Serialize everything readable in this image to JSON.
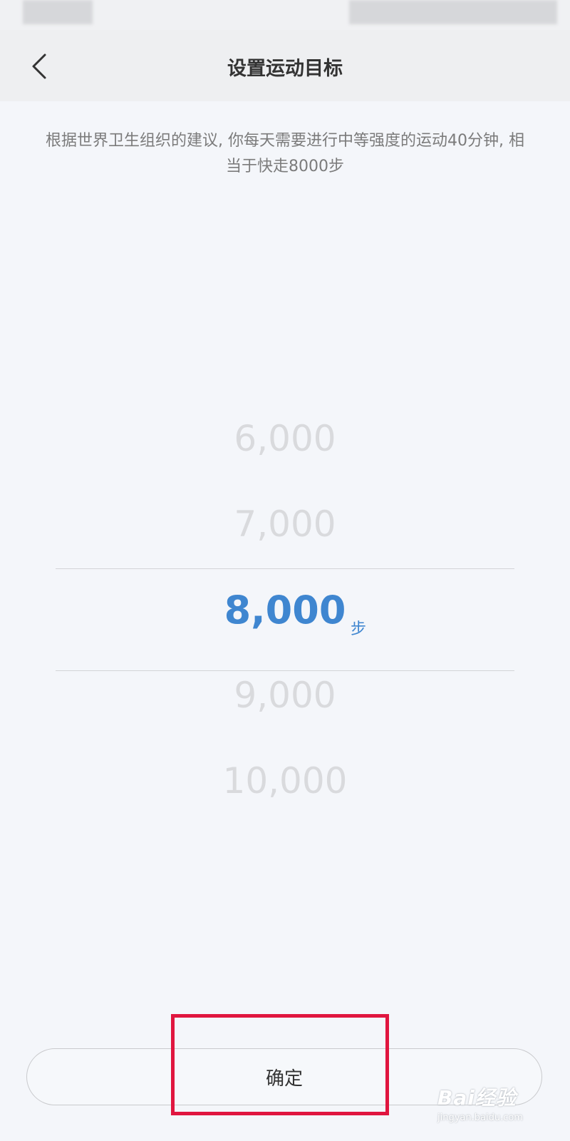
{
  "header": {
    "title": "设置运动目标"
  },
  "description": "根据世界卫生组织的建议, 你每天需要进行中等强度的运动40分钟, 相当于快走8000步",
  "picker": {
    "items": [
      "6,000",
      "7,000",
      "8,000",
      "9,000",
      "10,000"
    ],
    "selected_index": 2,
    "unit": "步"
  },
  "confirm_button": {
    "label": "确定"
  },
  "watermark": {
    "brand": "Bai经验",
    "url": "jingyan.baidu.com"
  },
  "colors": {
    "accent": "#3f86d0",
    "inactive": "#d9dadd",
    "highlight": "#e0163f",
    "background": "#f4f6fa"
  }
}
